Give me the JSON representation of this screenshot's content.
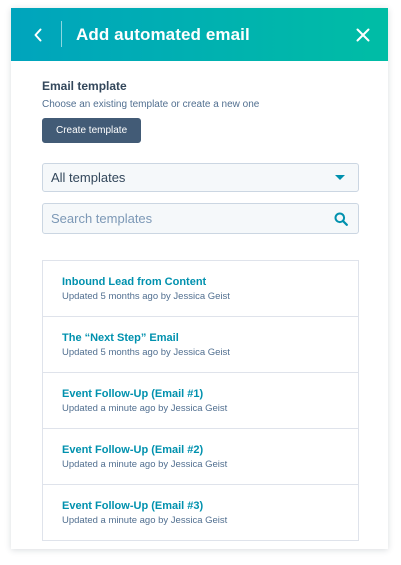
{
  "header": {
    "title": "Add automated email",
    "background_start": "#00a4bd",
    "background_end": "#00bda5"
  },
  "template_section": {
    "title": "Email template",
    "subtitle": "Choose an existing template or create a new one",
    "create_button_label": "Create template"
  },
  "filter": {
    "selected": "All templates"
  },
  "search": {
    "placeholder": "Search templates"
  },
  "templates": [
    {
      "name": "Inbound Lead from Content",
      "updated": "Updated 5 months ago by Jessica Geist"
    },
    {
      "name": "The “Next Step” Email",
      "updated": "Updated 5 months ago by Jessica Geist"
    },
    {
      "name": "Event Follow-Up (Email #1)",
      "updated": "Updated a minute ago by Jessica Geist"
    },
    {
      "name": "Event Follow-Up (Email #2)",
      "updated": "Updated a minute ago by Jessica Geist"
    },
    {
      "name": "Event Follow-Up (Email #3)",
      "updated": "Updated a minute ago by Jessica Geist"
    }
  ],
  "colors": {
    "link": "#0091ae",
    "button": "#425b76",
    "text": "#33475b",
    "muted": "#516f90"
  },
  "icons": {
    "back": "chevron-left-icon",
    "close": "close-icon",
    "dropdown": "caret-down-icon",
    "search": "search-icon"
  }
}
